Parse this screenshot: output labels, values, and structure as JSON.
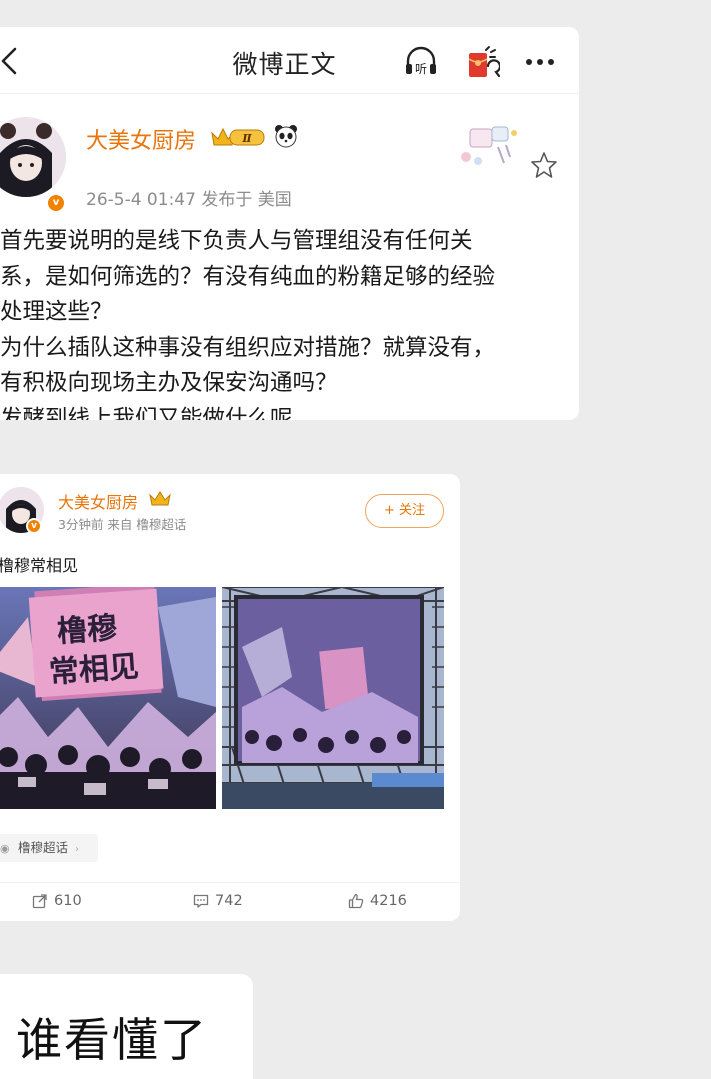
{
  "post_screen": {
    "title": "微博正文",
    "icons": {
      "back": "chevron-left-icon",
      "listen": "headphones-listen-icon",
      "listen_label": "听",
      "redpack": "red-envelope-icon",
      "more": "more-dots-icon"
    },
    "author": {
      "name": "大美女厨房",
      "level_badge": "Ⅱ",
      "meta": "26-5-4 01:47  发布于 美国"
    },
    "text_lines": [
      "首先要说明的是线下负责人与管理组没有任何关",
      "系，是如何筛选的？有没有纯血的粉籍足够的经验",
      "处理这些？",
      "为什么插队这种事没有组织应对措施？就算没有，",
      "有积极向现场主办及保安沟通吗？",
      "发酵到线上我们又能做什么呢"
    ]
  },
  "repost_card": {
    "author": {
      "name": "大美女厨房",
      "meta": "3分钟前  来自 橹穆超话"
    },
    "follow_label": "+ 关注",
    "text": "橹穆常相见",
    "banner_text_line1": "橹穆",
    "banner_text_line2": "常相见",
    "topic_tag": "橹穆超话",
    "actions": {
      "share_count": "610",
      "comment_count": "742",
      "like_count": "4216"
    }
  },
  "chat_bubble": {
    "text": "谁看懂了"
  },
  "colors": {
    "username": "#e8740a",
    "meta_gray": "#8c8c8c",
    "background": "#ececec",
    "card": "#ffffff"
  }
}
